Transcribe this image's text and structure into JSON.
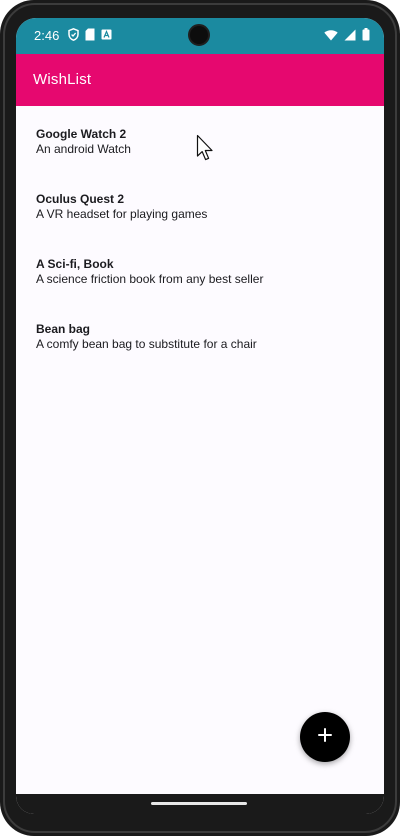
{
  "status_bar": {
    "time": "2:46",
    "left_icons": [
      "shield-icon",
      "sim-card-icon",
      "app-notification-icon"
    ],
    "right_icons": [
      "wifi-icon",
      "cell-signal-icon",
      "battery-icon"
    ],
    "color": "#1b8aa0"
  },
  "app_bar": {
    "title": "WishList",
    "color": "#e6086f"
  },
  "wishlist": {
    "items": [
      {
        "title": "Google Watch 2",
        "description": "An android Watch"
      },
      {
        "title": "Oculus Quest 2",
        "description": "A VR headset for playing games"
      },
      {
        "title": "A Sci-fi, Book",
        "description": "A science friction book from any best seller"
      },
      {
        "title": "Bean bag",
        "description": "A comfy bean bag to substitute for a chair"
      }
    ]
  },
  "fab": {
    "icon": "plus-icon",
    "color": "#000000"
  }
}
